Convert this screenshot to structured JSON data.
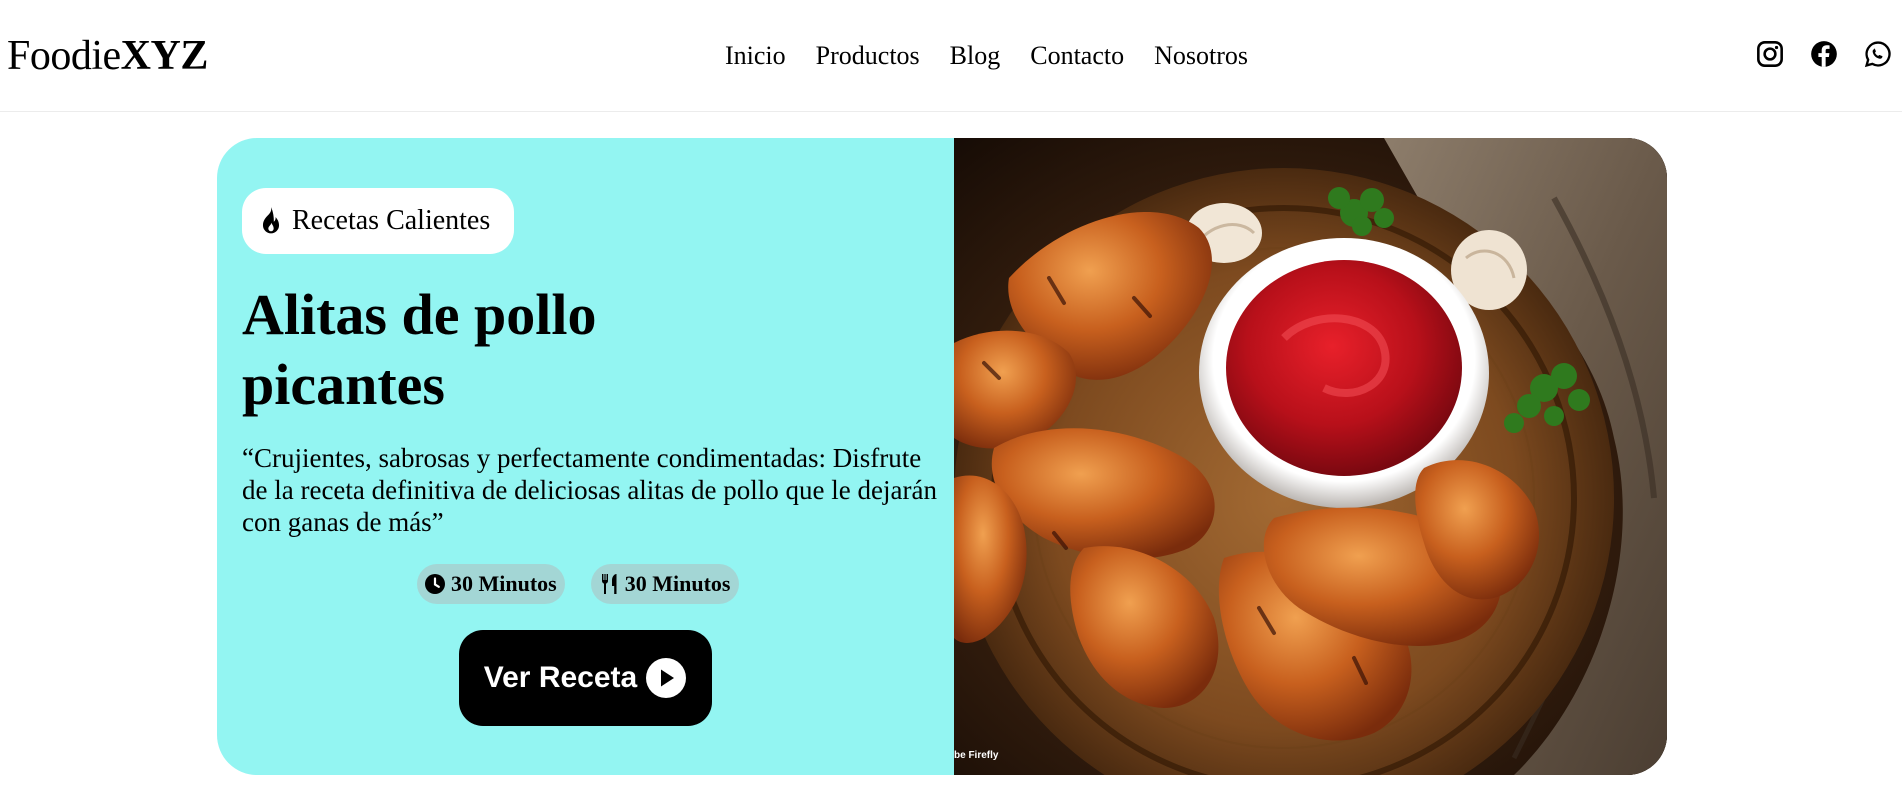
{
  "header": {
    "logo_regular": "Foodie",
    "logo_bold": "XYZ",
    "nav": [
      {
        "label": "Inicio"
      },
      {
        "label": "Productos"
      },
      {
        "label": "Blog"
      },
      {
        "label": "Contacto"
      },
      {
        "label": "Nosotros"
      }
    ],
    "social_icons": [
      "instagram-icon",
      "facebook-icon",
      "whatsapp-icon"
    ]
  },
  "hero": {
    "badge_label": "Recetas Calientes",
    "badge_icon": "flame-icon",
    "title": "Alitas de pollo picantes",
    "description": "“Crujientes, sabrosas y perfectamente condimentadas: Disfrute de la receta definitiva de deliciosas alitas de pollo que le dejarán con ganas de más”",
    "chips": [
      {
        "icon": "clock-icon",
        "label": "30 Minutos"
      },
      {
        "icon": "utensils-icon",
        "label": "30 Minutos"
      }
    ],
    "cta_label": "Ver Receta",
    "cta_icon": "play-circle-icon",
    "image_alt": "Alitas de pollo con salsa de tomate",
    "image_credit": "be Firefly",
    "accent_color": "#93f5f2",
    "chip_color": "#a3d6d5"
  }
}
